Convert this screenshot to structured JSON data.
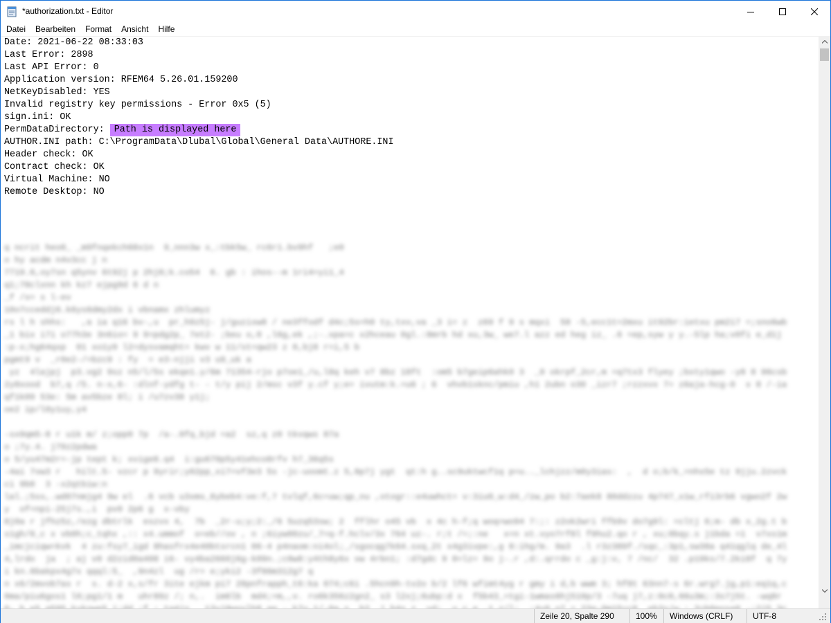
{
  "window": {
    "title": "*authorization.txt - Editor"
  },
  "menu": [
    "Datei",
    "Bearbeiten",
    "Format",
    "Ansicht",
    "Hilfe"
  ],
  "editor": {
    "lines": [
      "Date: 2021-06-22 08:33:03",
      "Last Error: 2898",
      "Last API Error: 0",
      "Application version: RFEM64 5.26.01.159200",
      "NetKeyDisabled: YES",
      "Invalid registry key permissions - Error 0x5 (5)",
      "sign.ini: OK"
    ],
    "perm_label": "PermDataDirectory: ",
    "perm_highlight": "Path is displayed here",
    "lines_after": [
      "AUTHOR.INI path: C:\\ProgramData\\Dlubal\\Global\\General Data\\AUTHORE.INI",
      "Header check: OK",
      "Contract check: OK",
      "Virtual Machine: NO",
      "Remote Desktop: NO"
    ]
  },
  "status": {
    "position": "Zeile 20, Spalte 290",
    "zoom": "100%",
    "line_ending": "Windows (CRLF)",
    "encoding": "UTF-8"
  },
  "colors": {
    "highlight": "#c77dff",
    "border": "#1a73d9"
  }
}
